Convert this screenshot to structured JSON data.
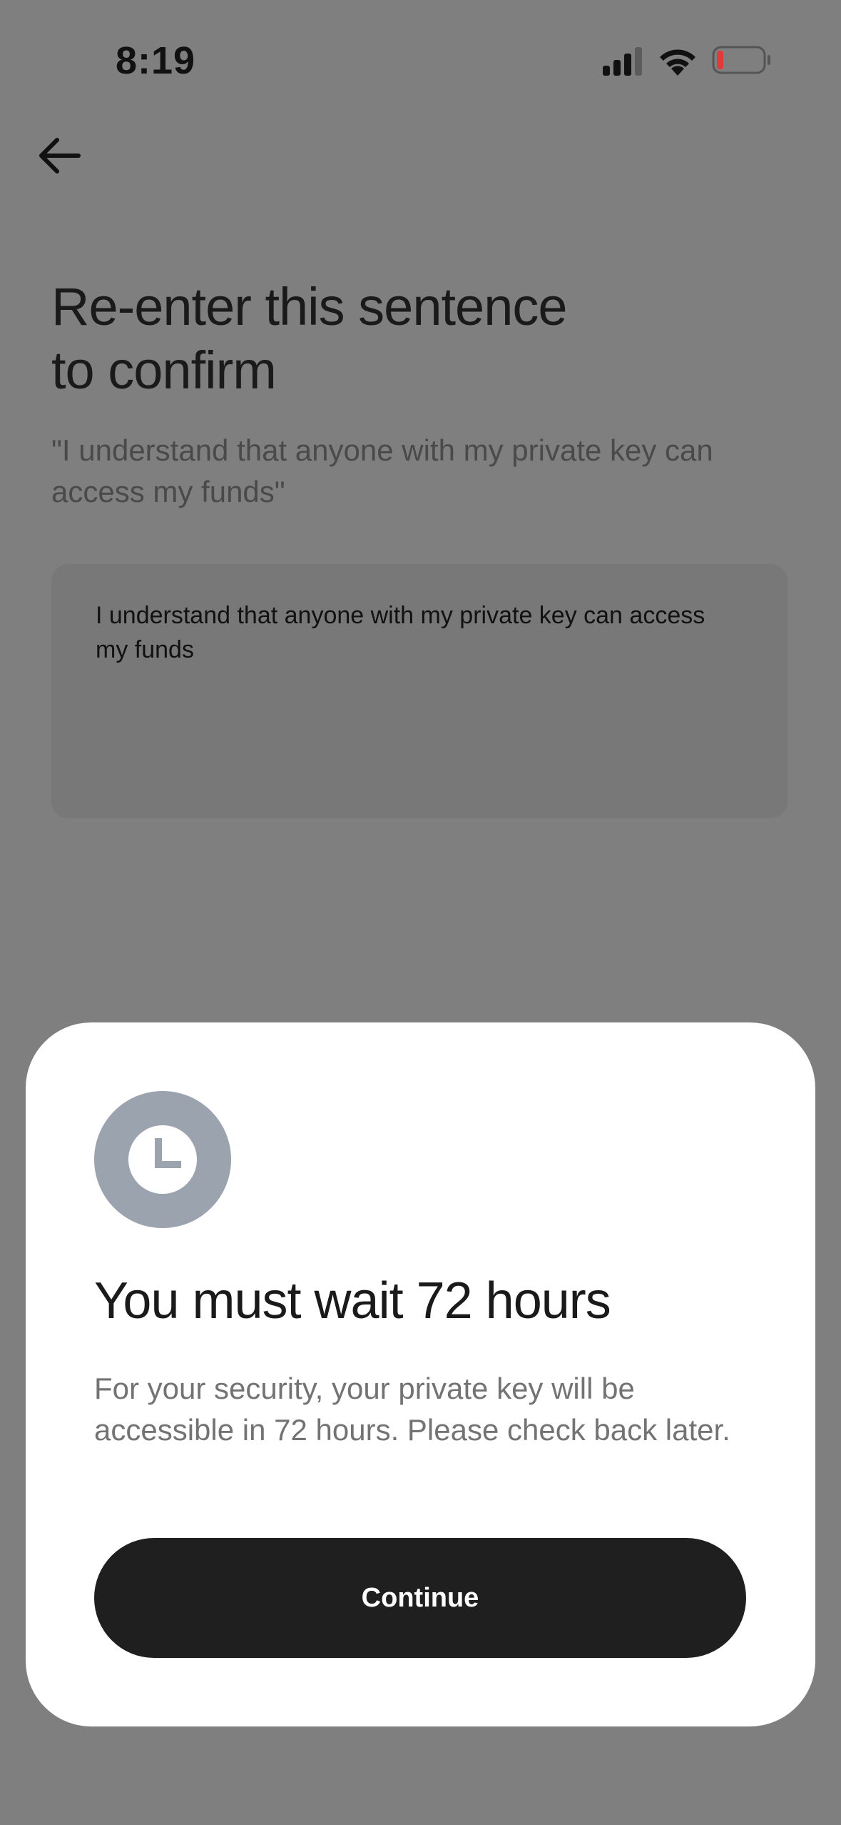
{
  "status_bar": {
    "time": "8:19",
    "icons": [
      "signal-icon",
      "wifi-icon",
      "battery-low-icon"
    ],
    "battery_color": "#e53935"
  },
  "navigation": {
    "back_icon": "arrow-left-icon"
  },
  "page": {
    "title_line1": "Re-enter this sentence",
    "title_line2": "to confirm",
    "subtitle": "\"I understand that anyone with my private key can access my funds\"",
    "input_value": "I understand that anyone with my private key can access my funds"
  },
  "sheet": {
    "icon": "clock-icon",
    "icon_bg_color": "#9ba3af",
    "title": "You must wait 72 hours",
    "body": "For your security, your private key will be accessible in 72 hours. Please check back later.",
    "continue_label": "Continue",
    "button_color": "#1f1f1f"
  }
}
